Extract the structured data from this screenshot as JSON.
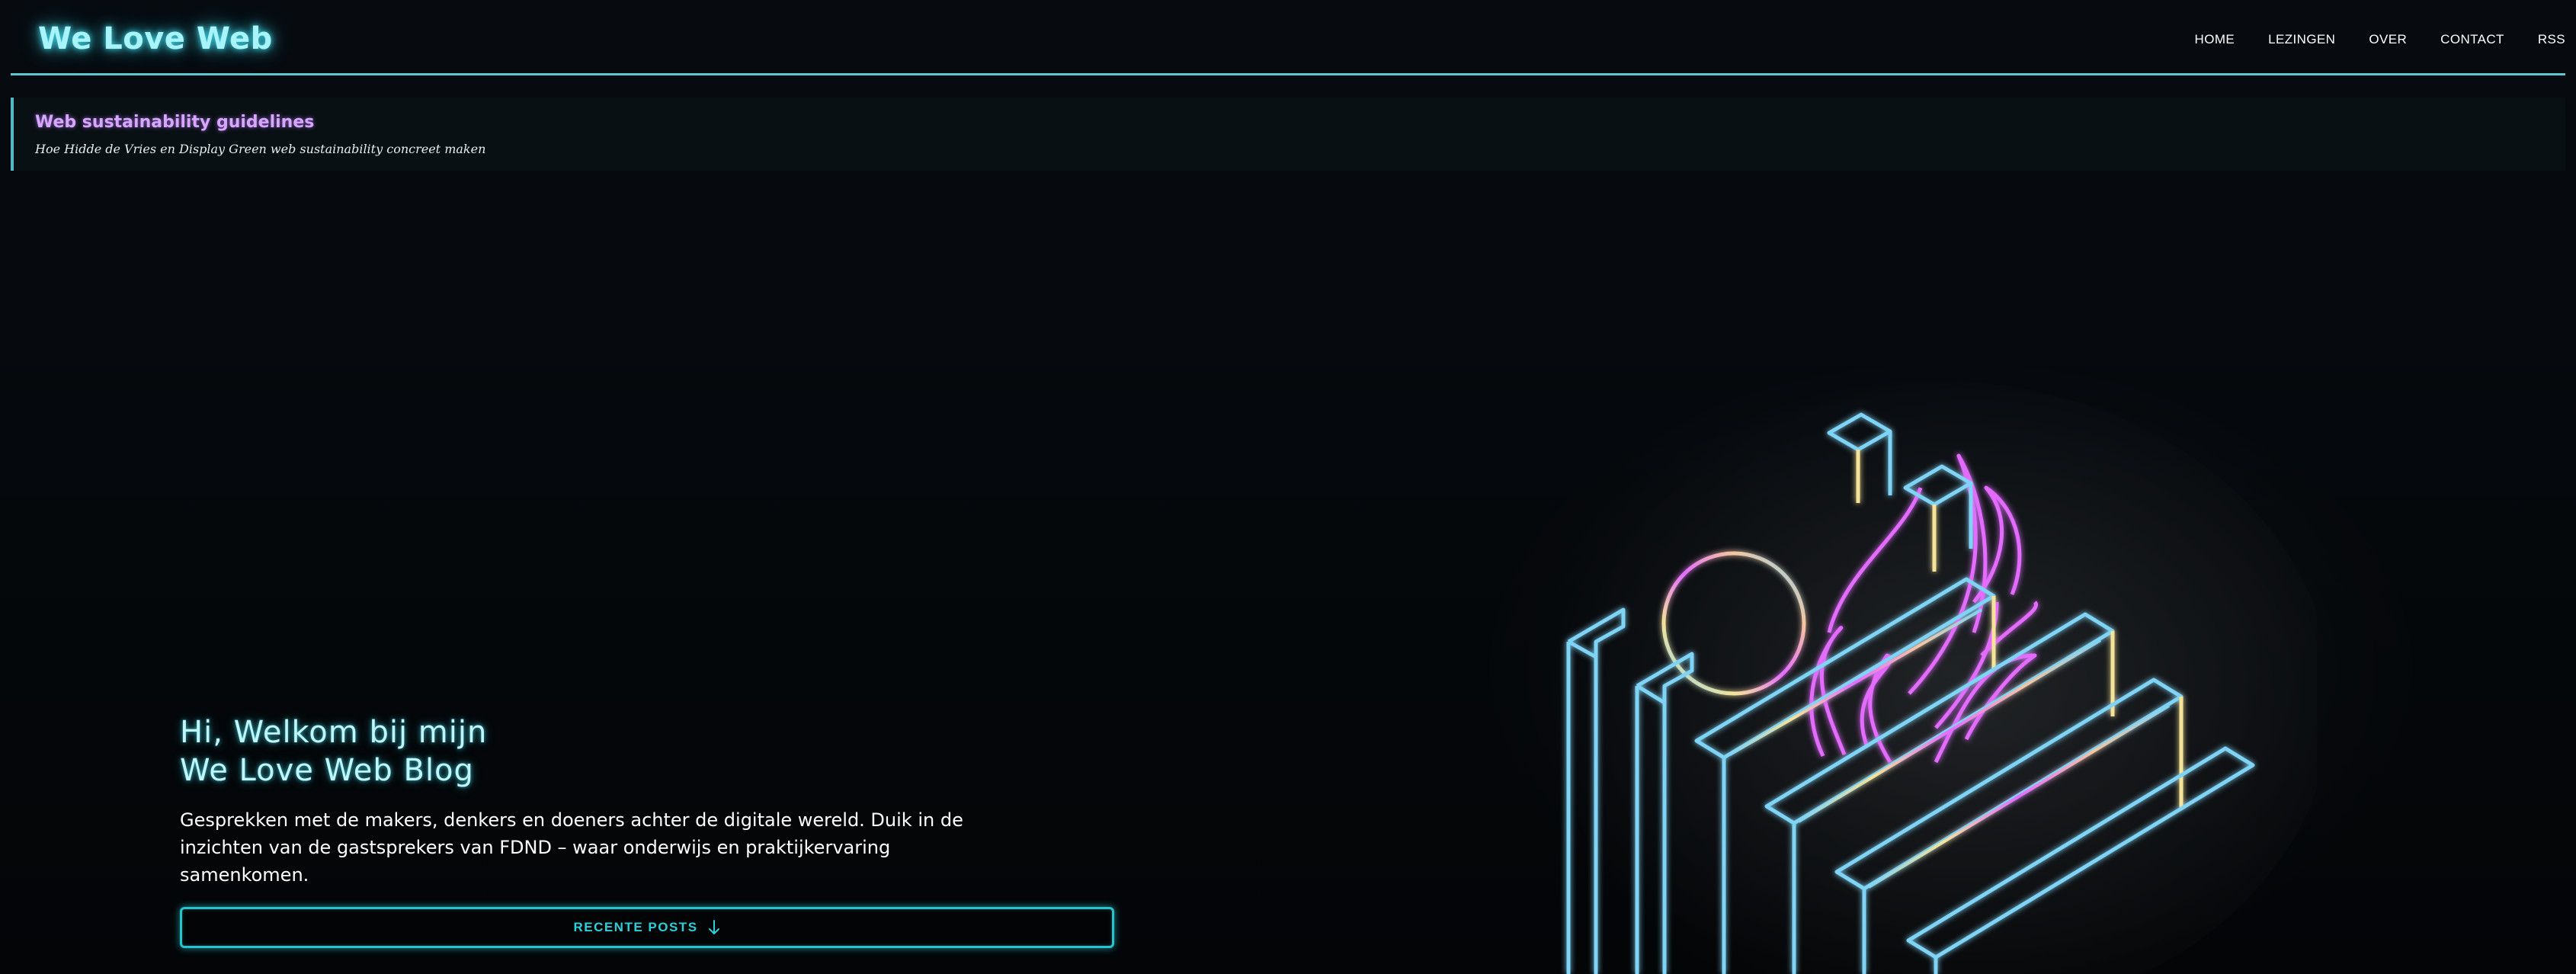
{
  "header": {
    "logo": "We Love Web",
    "nav": [
      "HOME",
      "LEZINGEN",
      "OVER",
      "CONTACT",
      "RSS"
    ]
  },
  "banner": {
    "title": "Web sustainability guidelines",
    "subtitle": "Hoe Hidde de Vries en Display Green web sustainability concreet maken"
  },
  "hero": {
    "title_line1": "Hi, Welkom bij mijn",
    "title_line2": "We Love Web Blog",
    "intro": "Gesprekken met de makers, denkers en doeners achter de digitale wereld. Duik in de inzichten van de gastsprekers van FDND – waar onderwijs en praktijkervaring samenkomen.",
    "cta_label": "RECENTE POSTS",
    "cta_icon": "arrow-down-icon"
  },
  "colors": {
    "background": "#05080c",
    "accent_cyan": "#3fd6e6",
    "accent_purple": "#d7a6ff",
    "neon_pink": "#e36cff",
    "neon_blue": "#7fd3f5",
    "neon_yellow": "#f5e39a"
  }
}
